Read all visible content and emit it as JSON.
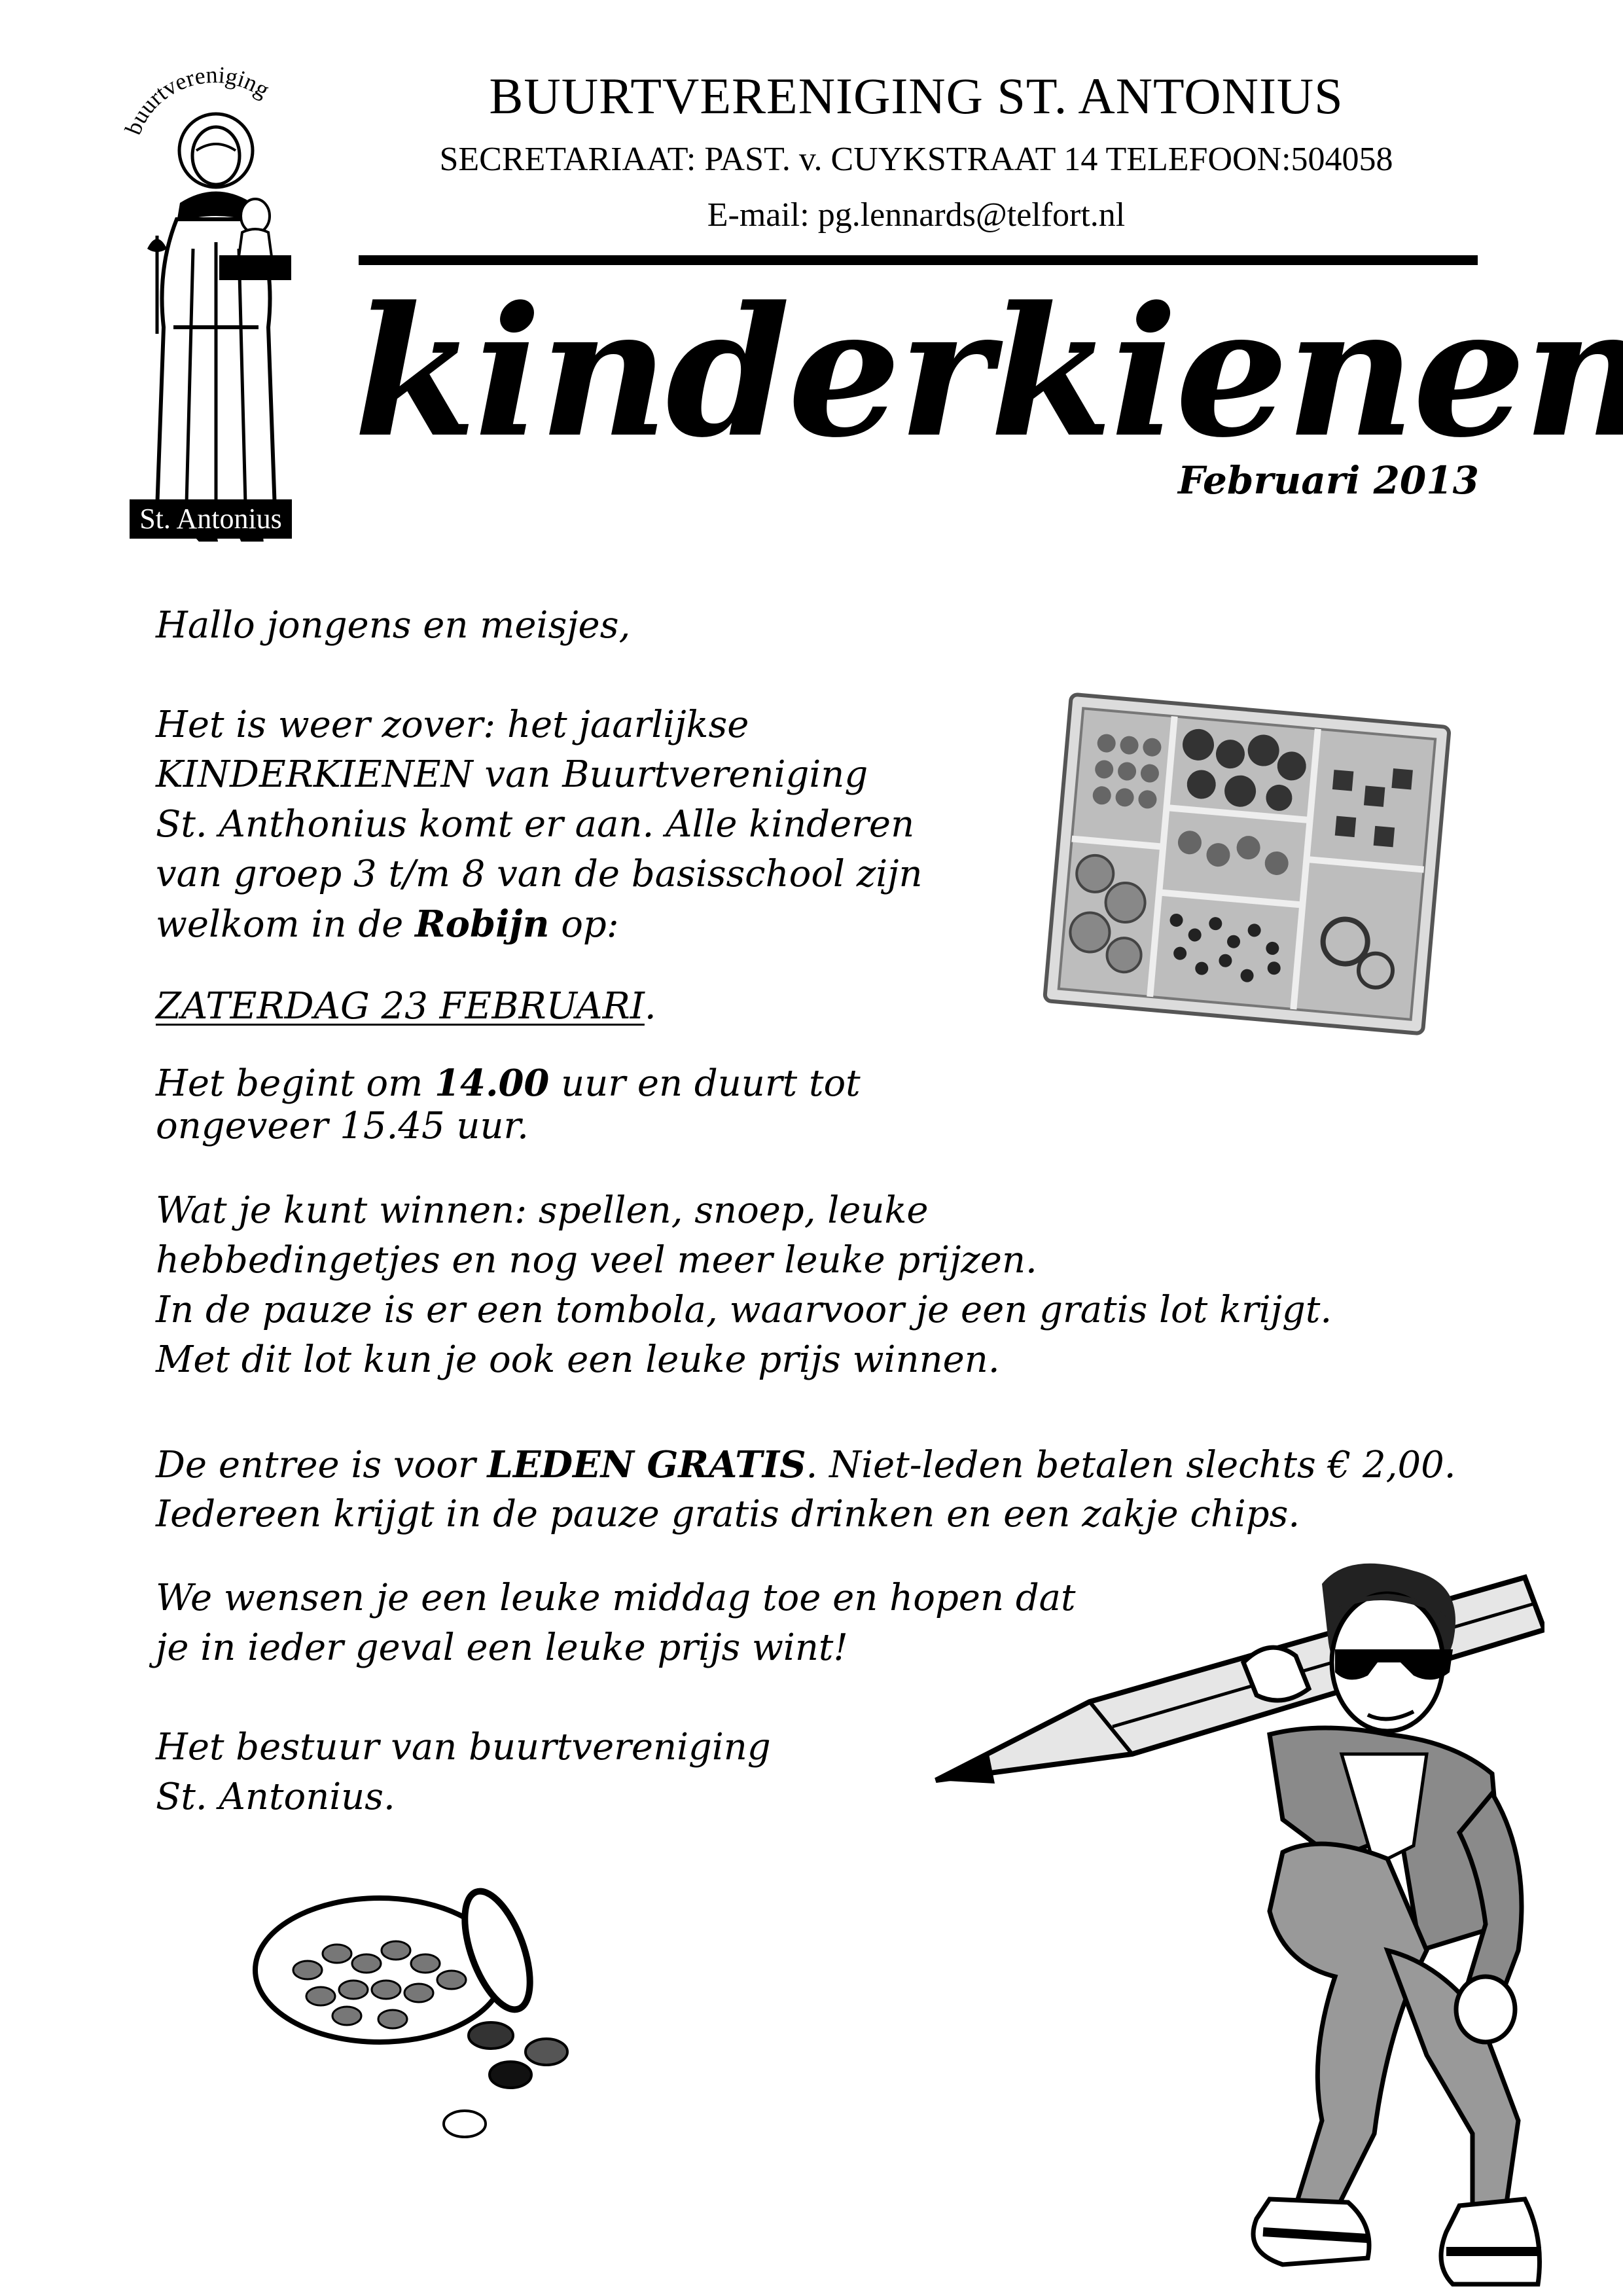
{
  "header": {
    "logo_arc_text": "buurtvereniging",
    "logo_badge": "St. Antonius",
    "title": "BUURTVERENIGING ST. ANTONIUS",
    "secretariaat": "SECRETARIAAT: PAST. v. CUYKSTRAAT 14 TELEFOON:504058",
    "email": "E-mail: pg.lennards@telfort.nl"
  },
  "event": {
    "title": "kinderkienen",
    "date": "Februari 2013"
  },
  "letter": {
    "greeting": "Hallo jongens en meisjes,",
    "intro": [
      "Het is weer zover: het jaarlijkse",
      "KINDERKIENEN van Buurtvereniging",
      "St. Anthonius komt er aan. Alle kinderen",
      "van groep 3 t/m 8 van de basisschool zijn"
    ],
    "welcome_pre": "welkom in de ",
    "welcome_place": "Robijn",
    "welcome_post": " op:",
    "event_day": "ZATERDAG 23 FEBRUARI",
    "event_day_dot": ".",
    "time_pre": "Het begint om ",
    "time_start": "14.00",
    "time_post": " uur en duurt tot",
    "time_end_line": "ongeveer 15.45 uur.",
    "prizes": [
      "Wat je kunt winnen: spellen, snoep, leuke",
      "hebbedingetjes  en nog veel meer leuke prijzen.",
      "In de pauze is er een tombola, waarvoor je een gratis lot krijgt.",
      "Met dit lot kun je ook een leuke prijs winnen."
    ],
    "entry_pre": "De entree is voor ",
    "entry_free": "LEDEN GRATIS",
    "entry_post": ". Niet-leden betalen slechts  € 2,00.",
    "entry_line2": "Iedereen krijgt in de pauze gratis drinken en een zakje chips.",
    "wish": [
      "We wensen je een leuke middag toe en hopen dat",
      "je in ieder geval een leuke prijs wint!"
    ],
    "signature": [
      "Het bestuur van buurtvereniging",
      "St. Antonius."
    ]
  }
}
